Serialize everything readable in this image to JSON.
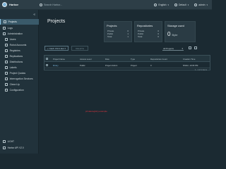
{
  "header": {
    "app_name": "Harbor",
    "search_placeholder": "Search Harbor...",
    "language": "English",
    "auth": "Default",
    "user": "admin"
  },
  "sidebar": {
    "items": [
      {
        "label": "Projects",
        "active": true,
        "indent": false
      },
      {
        "label": "Logs",
        "active": false,
        "indent": false
      },
      {
        "label": "Administration",
        "active": false,
        "indent": false
      },
      {
        "label": "Users",
        "active": false,
        "indent": true
      },
      {
        "label": "Robot Accounts",
        "active": false,
        "indent": true
      },
      {
        "label": "Registries",
        "active": false,
        "indent": true
      },
      {
        "label": "Replications",
        "active": false,
        "indent": true
      },
      {
        "label": "Distributions",
        "active": false,
        "indent": true
      },
      {
        "label": "Labels",
        "active": false,
        "indent": true
      },
      {
        "label": "Project Quotas",
        "active": false,
        "indent": true
      },
      {
        "label": "Interrogation Services",
        "active": false,
        "indent": true
      },
      {
        "label": "Clean Up",
        "active": false,
        "indent": true
      },
      {
        "label": "Configuration",
        "active": false,
        "indent": true
      }
    ],
    "bottom": [
      "LIGHT",
      "Harbor API V2.0"
    ]
  },
  "main": {
    "title": "Projects",
    "cards": {
      "projects": {
        "title": "Projects",
        "private_label": "Private",
        "private": "0",
        "public_label": "Public",
        "public": "1",
        "total_label": "Total",
        "total": "1"
      },
      "repositories": {
        "title": "Repositories",
        "private_label": "Private",
        "private": "0",
        "public_label": "Public",
        "public": "0",
        "total_label": "Total",
        "total": "0"
      },
      "storage": {
        "title": "Storage used",
        "value": "0",
        "unit": "Byte"
      }
    },
    "toolbar": {
      "new_project": "+ NEW PROJECT",
      "delete": "DELETE",
      "filter": "All Projects"
    },
    "table": {
      "headers": [
        "Project Name",
        "Access Level",
        "Role",
        "Type",
        "Repositories Count",
        "Creation Time"
      ],
      "rows": [
        [
          "library",
          "Public",
          "Project Admin",
          "Project",
          "0",
          "5/9/22, 10:06 PM"
        ]
      ],
      "footer": "1 - 1 of 1 items"
    },
    "red_link": "privateregistry.example"
  }
}
